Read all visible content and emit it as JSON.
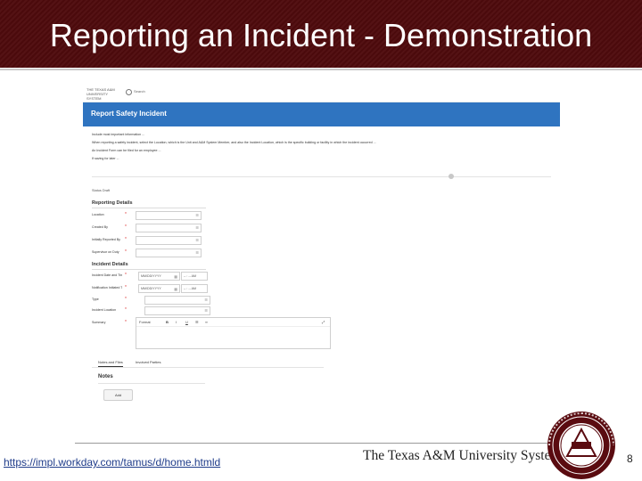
{
  "slide": {
    "title": "Reporting an Incident - Demonstration",
    "url": "https://impl.workday.com/tamus/d/home.htmld",
    "brand": "The Texas A&M University System",
    "page_number": "8",
    "seal_text": "A|M 1876"
  },
  "app": {
    "logo_line1": "THE TEXAS A&M",
    "logo_line2": "UNIVERSITY SYSTEM",
    "search_label": "Search",
    "page_title": "Report Safety Incident",
    "intro": [
      "Include most important information ...",
      "When reporting a safety incident, select the Location, which is the Unit and A&M System Member, and also the Incident Location, which is the specific building or facility in which the incident occurred ...",
      "An Incident Form can be filed for an employee ...",
      "If saving for later ..."
    ],
    "status_label": "Status",
    "status_value": "Draft",
    "reporting_section": "Reporting Details",
    "reporting_fields": [
      {
        "label": "Location"
      },
      {
        "label": "Created By"
      },
      {
        "label": "Initially Reported By"
      },
      {
        "label": "Supervisor on Duty"
      }
    ],
    "incident_section": "Incident Details",
    "incident_date_label": "Incident Date and Time",
    "incident_date_value": "MM/DD/YYYY",
    "incident_time_value": "-- : -- AM",
    "notification_label": "Notification Initiated Time",
    "notification_date_value": "MM/DD/YYYY",
    "notification_time_value": "-- : -- AM",
    "type_label": "Type",
    "incident_location_label": "Incident Location",
    "summary_label": "Summary",
    "rte_format": "Format",
    "rte_bold": "B",
    "rte_italic": "I",
    "rte_underline": "U",
    "tabs": [
      "Notes and Files",
      "Involved Parties"
    ],
    "notes_title": "Notes",
    "add_button": "Add"
  }
}
